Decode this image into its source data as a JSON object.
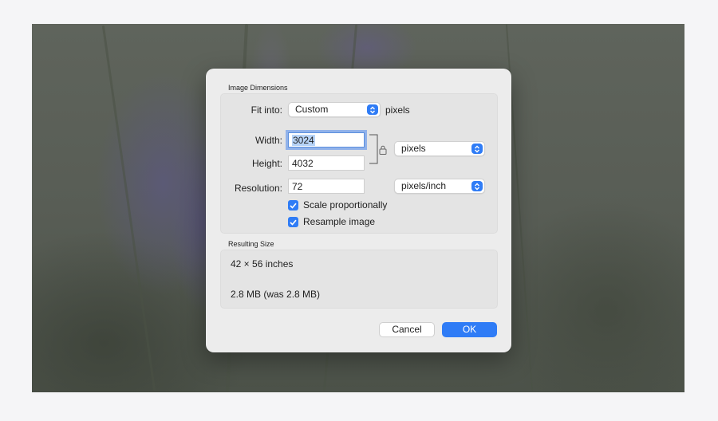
{
  "dimensions": {
    "section_title": "Image Dimensions",
    "fit_into_label": "Fit into:",
    "fit_into_value": "Custom",
    "fit_into_unit": "pixels",
    "width_label": "Width:",
    "width_value": "3024",
    "height_label": "Height:",
    "height_value": "4032",
    "size_unit": "pixels",
    "resolution_label": "Resolution:",
    "resolution_value": "72",
    "resolution_unit": "pixels/inch",
    "scale_proportionally": "Scale proportionally",
    "scale_checked": true,
    "resample_image": "Resample image",
    "resample_checked": true
  },
  "result": {
    "section_title": "Resulting Size",
    "size_text": "42 × 56 inches",
    "file_size_text": "2.8 MB (was 2.8 MB)"
  },
  "buttons": {
    "cancel": "Cancel",
    "ok": "OK"
  },
  "icons": {
    "lock": "lock-icon",
    "stepper": "stepper-icon",
    "checkmark": "checkmark-icon"
  },
  "colors": {
    "accent": "#2f7cf6"
  }
}
